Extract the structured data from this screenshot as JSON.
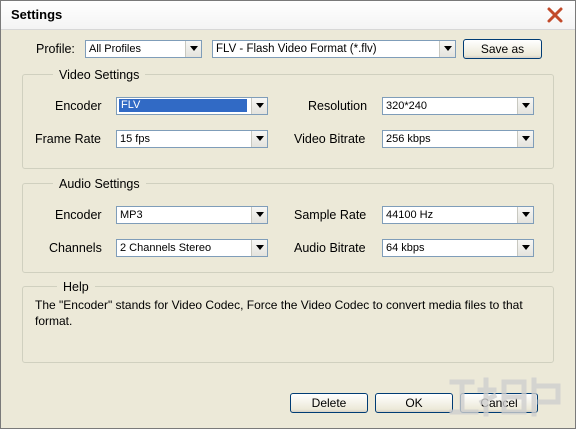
{
  "window": {
    "title": "Settings"
  },
  "profile": {
    "label": "Profile:",
    "category": "All Profiles",
    "format": "FLV - Flash Video Format (*.flv)",
    "save_as": "Save as"
  },
  "video": {
    "title": "Video Settings",
    "encoder_label": "Encoder",
    "encoder_value": "FLV",
    "resolution_label": "Resolution",
    "resolution_value": "320*240",
    "framerate_label": "Frame Rate",
    "framerate_value": "15 fps",
    "bitrate_label": "Video Bitrate",
    "bitrate_value": "256 kbps"
  },
  "audio": {
    "title": "Audio Settings",
    "encoder_label": "Encoder",
    "encoder_value": "MP3",
    "samplerate_label": "Sample Rate",
    "samplerate_value": "44100 Hz",
    "channels_label": "Channels",
    "channels_value": "2 Channels Stereo",
    "bitrate_label": "Audio Bitrate",
    "bitrate_value": "64 kbps"
  },
  "help": {
    "title": "Help",
    "text": "The \"Encoder\" stands for Video Codec, Force the Video Codec to convert media files to that format."
  },
  "buttons": {
    "delete": "Delete",
    "ok": "OK",
    "cancel": "Cancel"
  },
  "icons": {
    "close": "close-icon",
    "dropdown": "chevron-down-icon"
  },
  "colors": {
    "selection": "#316ac5",
    "close_x": "#c24a2a",
    "dialog_bg": "#ece9d8"
  }
}
